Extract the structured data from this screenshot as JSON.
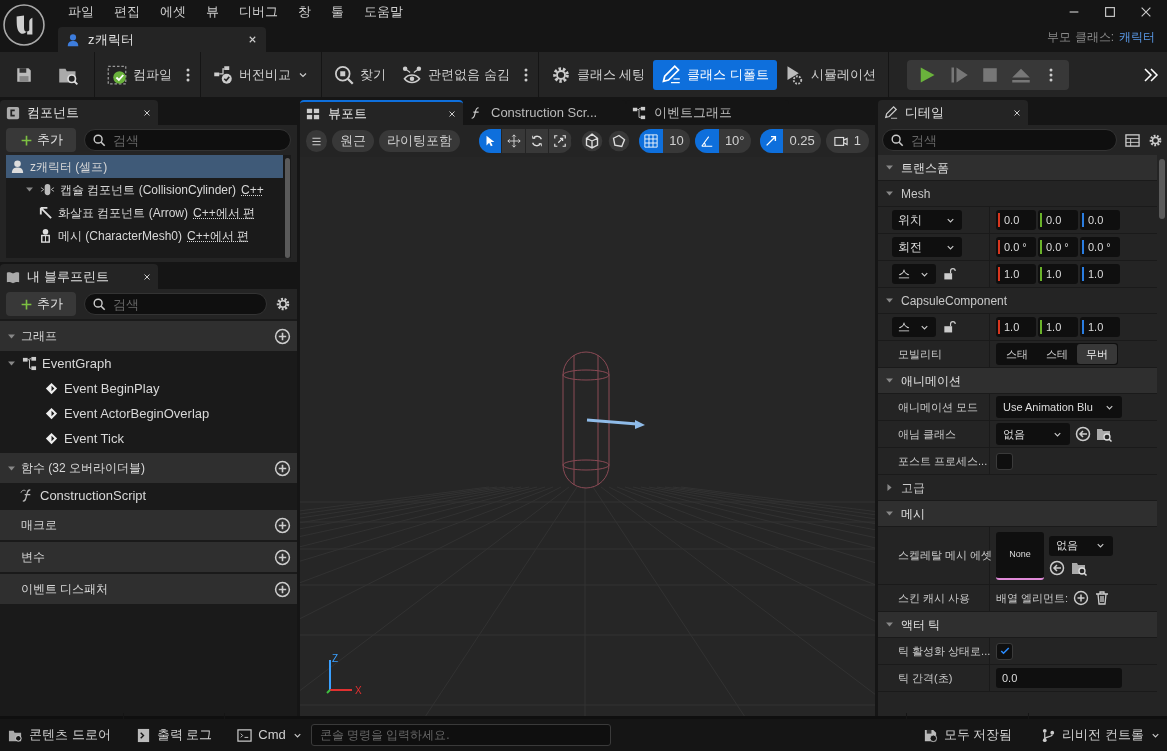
{
  "menu": [
    "파일",
    "편집",
    "에셋",
    "뷰",
    "디버그",
    "창",
    "툴",
    "도움말"
  ],
  "document_tab": {
    "label": "z캐릭터"
  },
  "parent_class": {
    "label": "부모 클래스:",
    "value": "캐릭터"
  },
  "toolbar": [
    {
      "label": "컴파일",
      "selected": false
    },
    {
      "label": "버전비교",
      "selected": false
    },
    {
      "label": "찾기",
      "selected": false
    },
    {
      "label": "관련없음 숨김",
      "selected": false
    },
    {
      "label": "클래스 세팅",
      "selected": false
    },
    {
      "label": "클래스 디폴트",
      "selected": true
    },
    {
      "label": "시뮬레이션",
      "selected": false
    }
  ],
  "components": {
    "title": "컴포넌트",
    "add_label": "추가",
    "search_placeholder": "검색",
    "tree": [
      {
        "label": "z캐릭터 (셀프)",
        "selected": true,
        "children": [
          {
            "label": "캡슐 컴포넌트 (CollisionCylinder)",
            "note": "C++",
            "selected": false,
            "expanded": true,
            "children": [
              {
                "label": "화살표 컴포넌트 (Arrow)",
                "note": "C++에서 편",
                "selected": false
              },
              {
                "label": "메시 (CharacterMesh0)",
                "note": "C++에서 편",
                "selected": false
              }
            ]
          }
        ]
      }
    ]
  },
  "my_blueprint": {
    "title": "내 블루프린트",
    "add_label": "추가",
    "search_placeholder": "검색",
    "sections": [
      {
        "title": "그래프",
        "items": [
          {
            "label": "EventGraph",
            "expanded": true,
            "children": [
              {
                "label": "Event BeginPlay"
              },
              {
                "label": "Event ActorBeginOverlap"
              },
              {
                "label": "Event Tick"
              }
            ]
          }
        ]
      },
      {
        "title": "함수 (32 오버라이더블)",
        "items": [
          {
            "label": "ConstructionScript"
          }
        ]
      },
      {
        "title": "매크로"
      },
      {
        "title": "변수"
      },
      {
        "title": "이벤트 디스패처"
      }
    ]
  },
  "viewport_tabs": [
    {
      "label": "뷰포트",
      "selected": true
    },
    {
      "label": "Construction Scr...",
      "selected": false
    },
    {
      "label": "이벤트그래프",
      "selected": false
    }
  ],
  "viewport_toolbar": {
    "view_mode": "원근",
    "lighting": "라이팅포함",
    "transform_tools": [
      {
        "selected": true
      },
      {
        "selected": false
      },
      {
        "selected": false
      },
      {
        "selected": false
      }
    ],
    "grid_snap": {
      "on": true,
      "value": "10"
    },
    "rotation_snap": {
      "on": true,
      "value": "10°"
    },
    "scale_snap": {
      "on": true,
      "value": "0.25"
    },
    "camera_speed": "1"
  },
  "axis_labels": [
    "Z",
    "X"
  ],
  "details": {
    "title": "디테일",
    "search_placeholder": "검색",
    "sections": [
      {
        "title": "트랜스폼",
        "expanded": true,
        "groups": [
          {
            "title": "Mesh",
            "expanded": true,
            "rows": [
              {
                "kind": "vector",
                "mode": "위치",
                "values": [
                  "0.0",
                  "0.0",
                  "0.0"
                ]
              },
              {
                "kind": "vector",
                "mode": "회전",
                "values": [
                  "0.0 °",
                  "0.0 °",
                  "0.0 °"
                ]
              },
              {
                "kind": "scale",
                "mode": "스",
                "locked": false,
                "values": [
                  "1.0",
                  "1.0",
                  "1.0"
                ]
              }
            ]
          },
          {
            "title": "CapsuleComponent",
            "expanded": true,
            "rows": [
              {
                "kind": "scale",
                "mode": "스",
                "locked": false,
                "values": [
                  "1.0",
                  "1.0",
                  "1.0"
                ]
              },
              {
                "kind": "segmented",
                "label": "모빌리티",
                "options": [
                  {
                    "label": "스태",
                    "selected": false
                  },
                  {
                    "label": "스테",
                    "selected": false
                  },
                  {
                    "label": "무버",
                    "selected": true
                  }
                ]
              }
            ]
          }
        ]
      },
      {
        "title": "애니메이션",
        "expanded": true,
        "rows": [
          {
            "kind": "dropdown",
            "label": "애니메이션 모드",
            "value": "Use Animation Blu"
          },
          {
            "kind": "class_picker",
            "label": "애님 클래스",
            "value": "없음"
          },
          {
            "kind": "checkbox",
            "label": "포스트 프로세스...",
            "checked": false
          },
          {
            "kind": "advanced",
            "label": "고급",
            "expanded": false
          }
        ]
      },
      {
        "title": "메시",
        "expanded": true,
        "rows": [
          {
            "kind": "asset",
            "label": "스켈레탈 메시 에셋",
            "thumbnail": "None",
            "value": "없음"
          },
          {
            "kind": "array",
            "label": "스킨 캐시 사용",
            "value": "배열 엘리먼트:"
          }
        ]
      },
      {
        "title": "액터 틱",
        "expanded": true,
        "rows": [
          {
            "kind": "checkbox",
            "label": "틱 활성화 상태로...",
            "checked": true
          },
          {
            "kind": "number",
            "label": "틱 간격(초)",
            "value": "0.0"
          }
        ]
      }
    ]
  },
  "bottom_bar": {
    "content_drawer": "콘텐츠 드로어",
    "output_log": "출력 로그",
    "console_mode": "Cmd",
    "console_placeholder": "콘솔 명령을 입력하세요.",
    "save_status": "모두 저장됨",
    "revision_control": "리비전 컨트롤"
  }
}
